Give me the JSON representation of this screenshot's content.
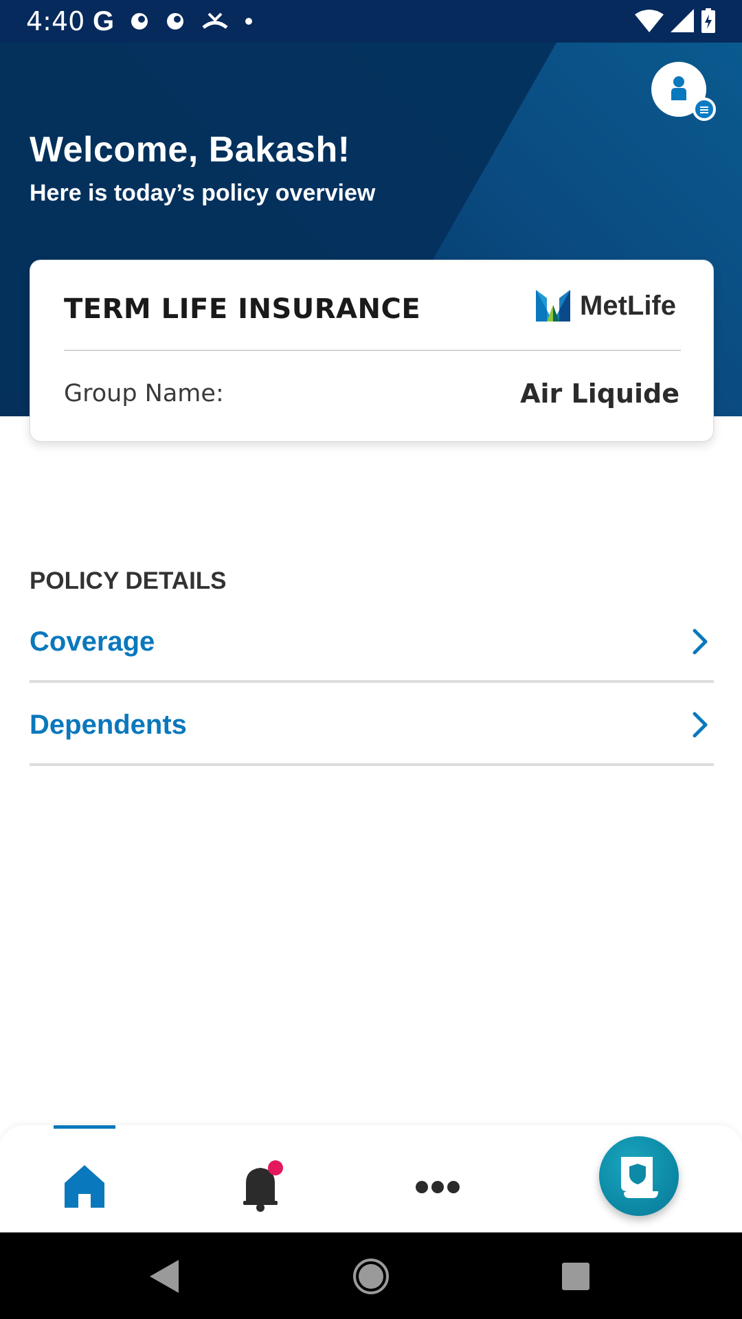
{
  "status_bar": {
    "time": "4:40",
    "left_icons": [
      "google-icon",
      "app-notification-icon",
      "app-notification-icon",
      "missed-call-icon",
      "dot-icon"
    ],
    "right_icons": [
      "wifi-icon",
      "signal-icon",
      "battery-icon"
    ]
  },
  "header": {
    "title": "Welcome, Bakash!",
    "subtitle": "Here is today’s policy overview",
    "profile_icon": "profile-menu-icon"
  },
  "policy_card": {
    "policy_type": "TERM LIFE INSURANCE",
    "brand": "MetLife",
    "group_label": "Group Name:",
    "group_value": "Air Liquide"
  },
  "policy_details": {
    "section_title": "POLICY DETAILS",
    "items": [
      {
        "label": "Coverage",
        "icon": "chevron-right-icon"
      },
      {
        "label": "Dependents",
        "icon": "chevron-right-icon"
      }
    ]
  },
  "bottom_nav": {
    "items": [
      "home-icon",
      "bell-icon",
      "more-icon"
    ],
    "active": "home",
    "fab_icon": "policy-document-icon",
    "notification_dot": true
  },
  "colors": {
    "header_dark": "#042f5a",
    "header_light": "#0a5a8f",
    "accent_blue": "#0a78bc",
    "fab_teal": "#0d8aa6",
    "notification_pink": "#e3195c"
  }
}
